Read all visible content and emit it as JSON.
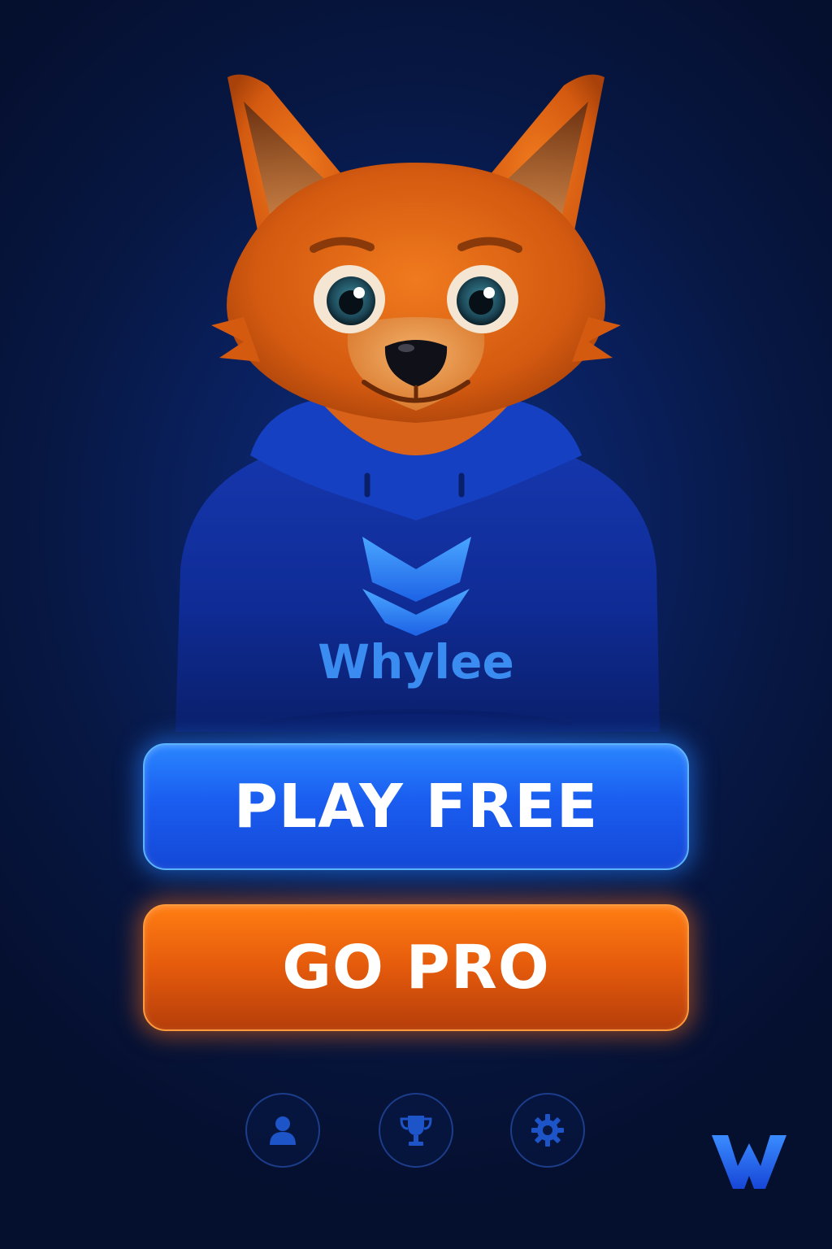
{
  "mascot": {
    "hoodie_brand": "Whylee"
  },
  "actions": {
    "play_free_label": "PLAY FREE",
    "go_pro_label": "GO PRO"
  },
  "nav": {
    "items": [
      {
        "icon": "profile-icon"
      },
      {
        "icon": "trophy-icon"
      },
      {
        "icon": "settings-icon"
      }
    ]
  },
  "colors": {
    "background": "#071742",
    "play_button": "#1a5df0",
    "pro_button": "#e45a0c",
    "hoodie": "#0f2f9e",
    "fox_fur": "#e2620f",
    "accent_logo": "#2f7bff"
  }
}
